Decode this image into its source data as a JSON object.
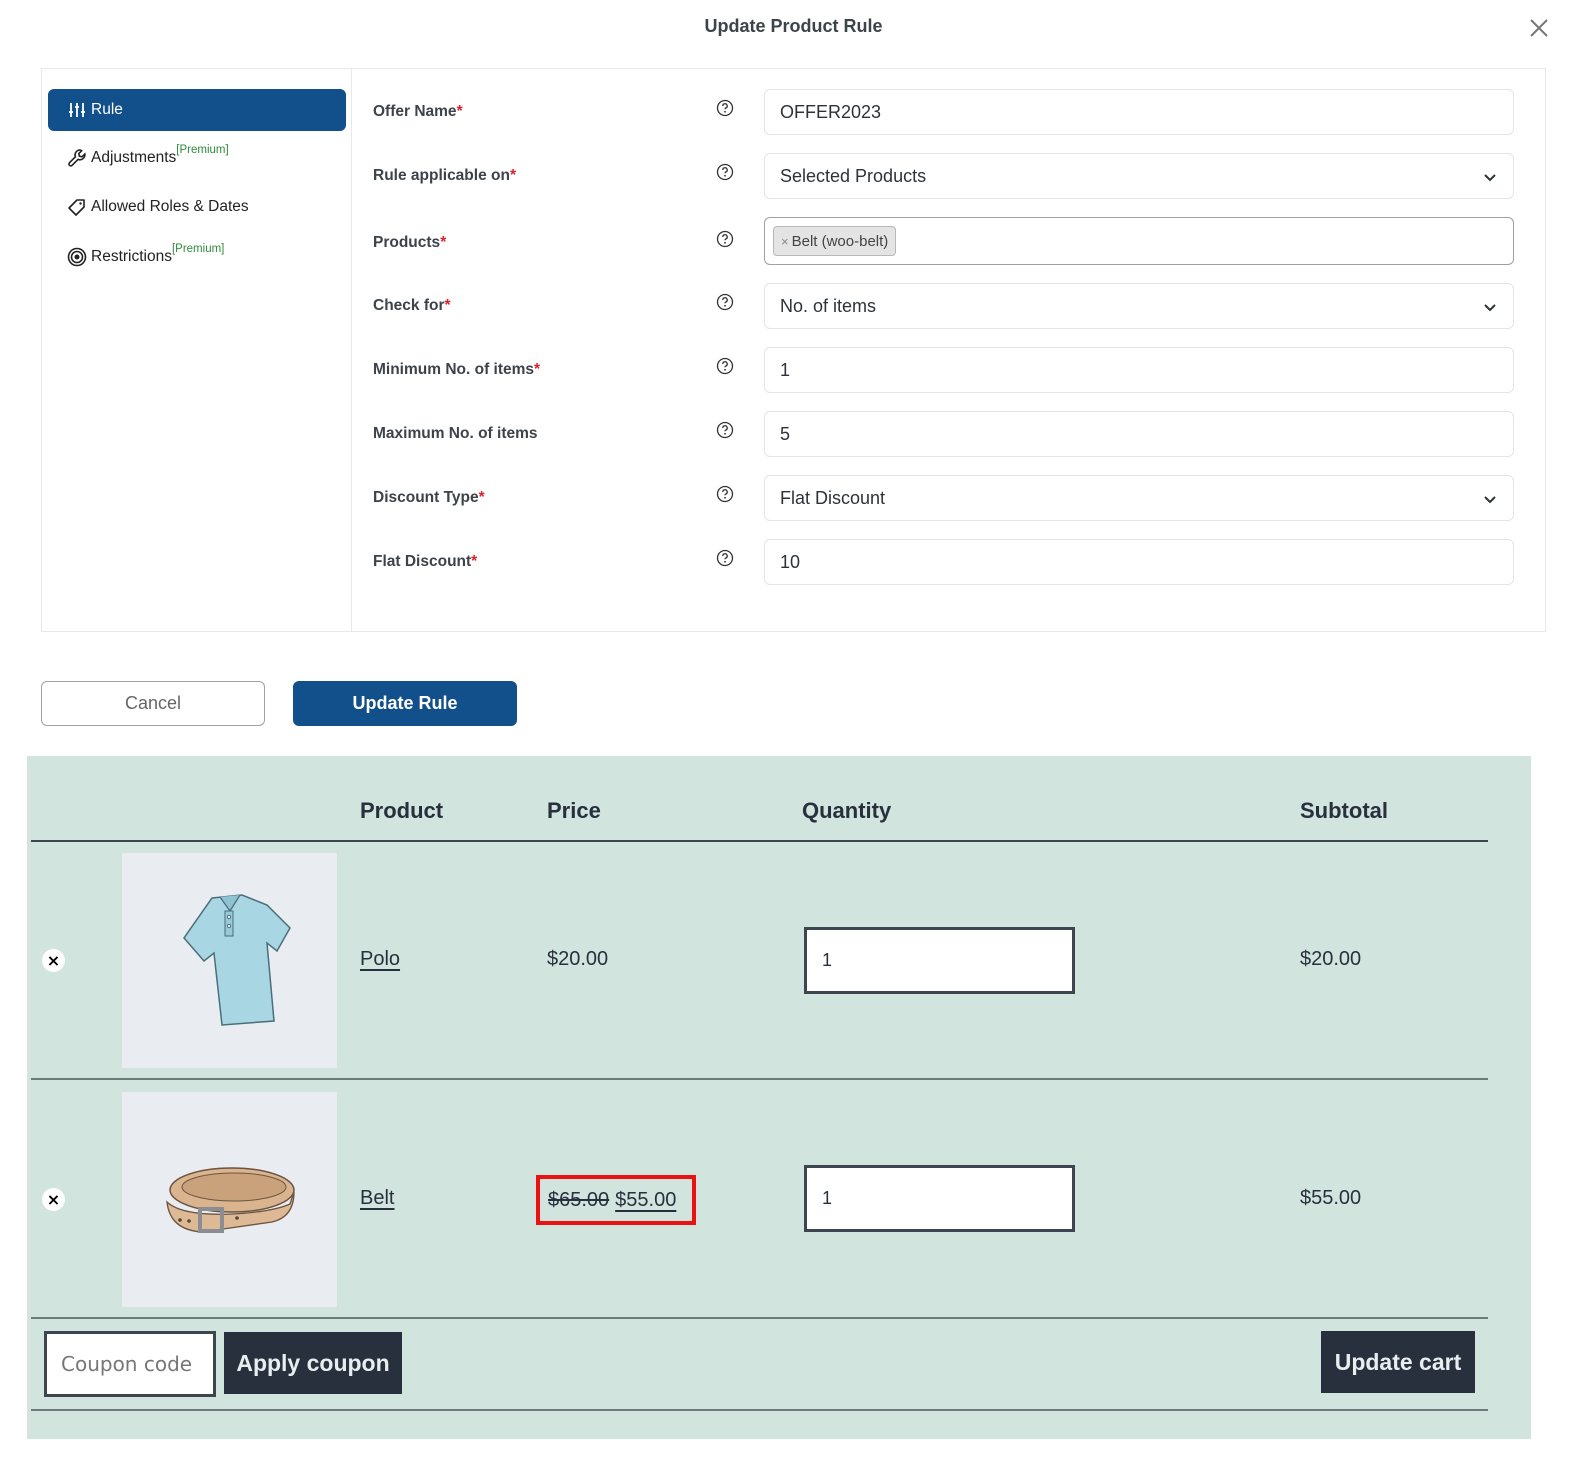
{
  "modal": {
    "title": "Update Product Rule",
    "close_icon": "close-icon"
  },
  "sidebar": {
    "items": [
      {
        "label": "Rule",
        "icon": "sliders-icon",
        "premium": "",
        "active": true
      },
      {
        "label": "Adjustments",
        "icon": "wrench-icon",
        "premium": "[Premium]",
        "active": false
      },
      {
        "label": "Allowed Roles & Dates",
        "icon": "tag-icon",
        "premium": "",
        "active": false
      },
      {
        "label": "Restrictions",
        "icon": "target-icon",
        "premium": "[Premium]",
        "active": false
      }
    ]
  },
  "form": {
    "fields": [
      {
        "label": "Offer Name",
        "required": "*",
        "type": "text",
        "value": "OFFER2023"
      },
      {
        "label": "Rule applicable on",
        "required": "*",
        "type": "select",
        "value": "Selected Products"
      },
      {
        "label": "Products",
        "required": "*",
        "type": "multiselect",
        "chips": [
          "Belt (woo-belt)"
        ]
      },
      {
        "label": "Check for",
        "required": "*",
        "type": "select",
        "value": "No. of items"
      },
      {
        "label": "Minimum No. of items",
        "required": "*",
        "type": "text",
        "value": "1"
      },
      {
        "label": "Maximum No. of items",
        "required": "",
        "type": "text",
        "value": "5"
      },
      {
        "label": "Discount Type",
        "required": "*",
        "type": "select",
        "value": "Flat Discount"
      },
      {
        "label": "Flat Discount",
        "required": "*",
        "type": "text",
        "value": "10"
      }
    ],
    "chip_remove": "×"
  },
  "actions": {
    "cancel_label": "Cancel",
    "update_label": "Update Rule"
  },
  "cart": {
    "headers": {
      "product": "Product",
      "price": "Price",
      "quantity": "Quantity",
      "subtotal": "Subtotal"
    },
    "rows": [
      {
        "name": "Polo",
        "price": "$20.00",
        "quantity": "1",
        "subtotal": "$20.00",
        "image": "polo-shirt"
      },
      {
        "name": "Belt",
        "regular_price": "$65.00",
        "sale_price": "$55.00",
        "quantity": "1",
        "subtotal": "$55.00",
        "image": "belt"
      }
    ],
    "remove_symbol": "×",
    "coupon_placeholder": "Coupon code",
    "apply_coupon_label": "Apply coupon",
    "update_cart_label": "Update cart"
  },
  "colors": {
    "primary": "#12508c",
    "cart_bg": "#d1e4de",
    "dark_button": "#28303d",
    "highlight": "#ee1111",
    "premium": "#2e8b3a",
    "required": "#e0202a"
  }
}
